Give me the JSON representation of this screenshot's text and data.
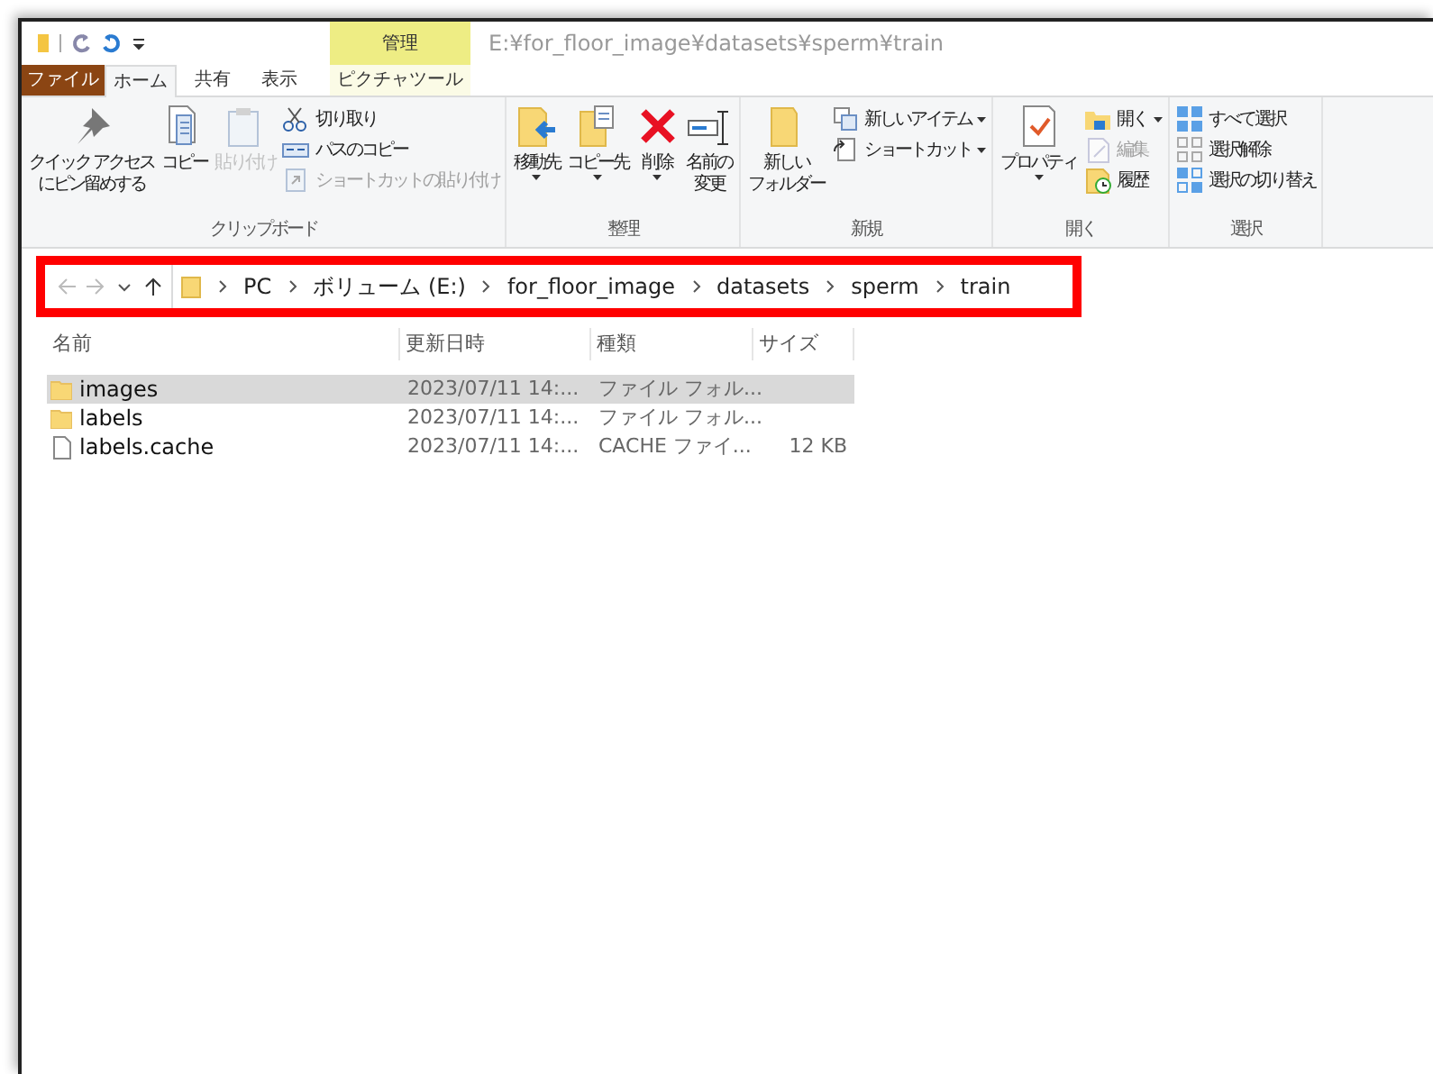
{
  "window": {
    "title": "E:¥for_floor_image¥datasets¥sperm¥train",
    "contextual_header": "管理"
  },
  "tabs": [
    {
      "label": "ファイル",
      "kind": "file",
      "selected": false
    },
    {
      "label": "ホーム",
      "kind": "normal",
      "selected": true
    },
    {
      "label": "共有",
      "kind": "normal",
      "selected": false
    },
    {
      "label": "表示",
      "kind": "normal",
      "selected": false
    },
    {
      "label": "ピクチャツール",
      "kind": "contextual",
      "selected": false
    }
  ],
  "ribbon": {
    "groups": [
      {
        "name": "クリップボード",
        "commands": [
          {
            "lines": [
              "クイック アクセス",
              "にピン留めする"
            ],
            "kind": "large",
            "disabled": false,
            "dropdown": false
          },
          {
            "lines": [
              "コピー"
            ],
            "kind": "large",
            "disabled": false,
            "dropdown": false
          },
          {
            "lines": [
              "貼り付け"
            ],
            "kind": "large",
            "disabled": true,
            "dropdown": false
          },
          {
            "label": "切り取り",
            "kind": "small",
            "disabled": false,
            "dropdown": false
          },
          {
            "label": "パスのコピー",
            "kind": "small",
            "disabled": false,
            "dropdown": false
          },
          {
            "label": "ショートカットの貼り付け",
            "kind": "small",
            "disabled": true,
            "dropdown": false
          }
        ]
      },
      {
        "name": "整理",
        "commands": [
          {
            "lines": [
              "移動先"
            ],
            "kind": "large",
            "disabled": false,
            "dropdown": true
          },
          {
            "lines": [
              "コピー先"
            ],
            "kind": "large",
            "disabled": false,
            "dropdown": true
          },
          {
            "lines": [
              "削除"
            ],
            "kind": "large",
            "disabled": false,
            "dropdown": true
          },
          {
            "lines": [
              "名前の",
              "変更"
            ],
            "kind": "large",
            "disabled": false,
            "dropdown": false
          }
        ]
      },
      {
        "name": "新規",
        "commands": [
          {
            "lines": [
              "新しい",
              "フォルダー"
            ],
            "kind": "large",
            "disabled": false,
            "dropdown": false
          },
          {
            "label": "新しいアイテム",
            "kind": "small",
            "disabled": false,
            "dropdown": true
          },
          {
            "label": "ショートカット",
            "kind": "small",
            "disabled": false,
            "dropdown": true
          }
        ]
      },
      {
        "name": "開く",
        "commands": [
          {
            "lines": [
              "プロパティ"
            ],
            "kind": "large",
            "disabled": false,
            "dropdown": true
          },
          {
            "label": "開く",
            "kind": "small",
            "disabled": false,
            "dropdown": true
          },
          {
            "label": "編集",
            "kind": "small",
            "disabled": true,
            "dropdown": false
          },
          {
            "label": "履歴",
            "kind": "small",
            "disabled": false,
            "dropdown": false
          }
        ]
      },
      {
        "name": "選択",
        "commands": [
          {
            "label": "すべて選択",
            "kind": "small",
            "disabled": false,
            "dropdown": false
          },
          {
            "label": "選択解除",
            "kind": "small",
            "disabled": false,
            "dropdown": false
          },
          {
            "label": "選択の切り替え",
            "kind": "small",
            "disabled": false,
            "dropdown": false
          }
        ]
      }
    ]
  },
  "address_bar": {
    "highlighted": true,
    "back_disabled": true,
    "forward_disabled": true,
    "breadcrumbs": [
      "PC",
      "ボリューム (E:)",
      "for_floor_image",
      "datasets",
      "sperm",
      "train"
    ]
  },
  "file_list": {
    "columns": [
      "名前",
      "更新日時",
      "種類",
      "サイズ"
    ],
    "rows": [
      {
        "kind": "folder",
        "name": "images",
        "modified": "2023/07/11 14:...",
        "type": "ファイル フォル...",
        "size": "",
        "selected": true
      },
      {
        "kind": "folder",
        "name": "labels",
        "modified": "2023/07/11 14:...",
        "type": "ファイル フォル...",
        "size": "",
        "selected": false
      },
      {
        "kind": "file",
        "name": "labels.cache",
        "modified": "2023/07/11 14:...",
        "type": "CACHE ファイ...",
        "size": "12 KB",
        "selected": false
      }
    ]
  }
}
